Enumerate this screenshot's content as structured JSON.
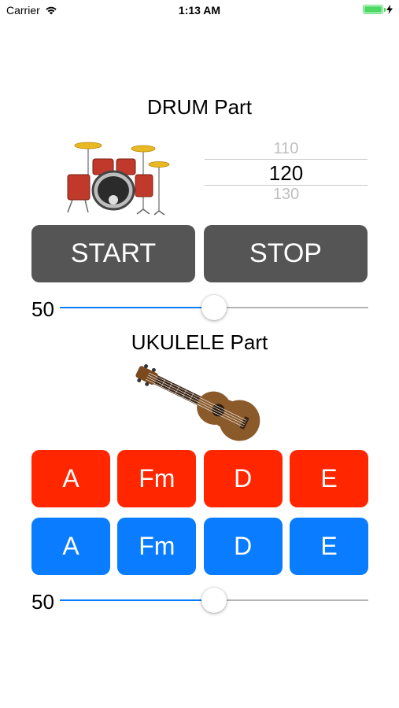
{
  "status_bar": {
    "carrier": "Carrier",
    "time": "1:13 AM",
    "battery_level": 1.0,
    "battery_color": "#4cd964"
  },
  "drum": {
    "title": "DRUM Part",
    "image": "drum-kit",
    "tempo_picker": {
      "above": "110",
      "selected": "120",
      "below": "130"
    },
    "start_label": "START",
    "stop_label": "STOP",
    "button_color": "#555555",
    "volume": {
      "value": 50,
      "display": "50",
      "max": 100
    }
  },
  "ukulele": {
    "title": "UKULELE Part",
    "image": "ukulele",
    "minor_chords": {
      "color": "#ff2600",
      "labels": [
        "A",
        "Fm",
        "D",
        "E"
      ]
    },
    "major_chords": {
      "color": "#0a7cff",
      "labels": [
        "A",
        "Fm",
        "D",
        "E"
      ]
    },
    "volume": {
      "value": 50,
      "display": "50",
      "max": 100
    }
  },
  "accent_color": "#0a7cff"
}
